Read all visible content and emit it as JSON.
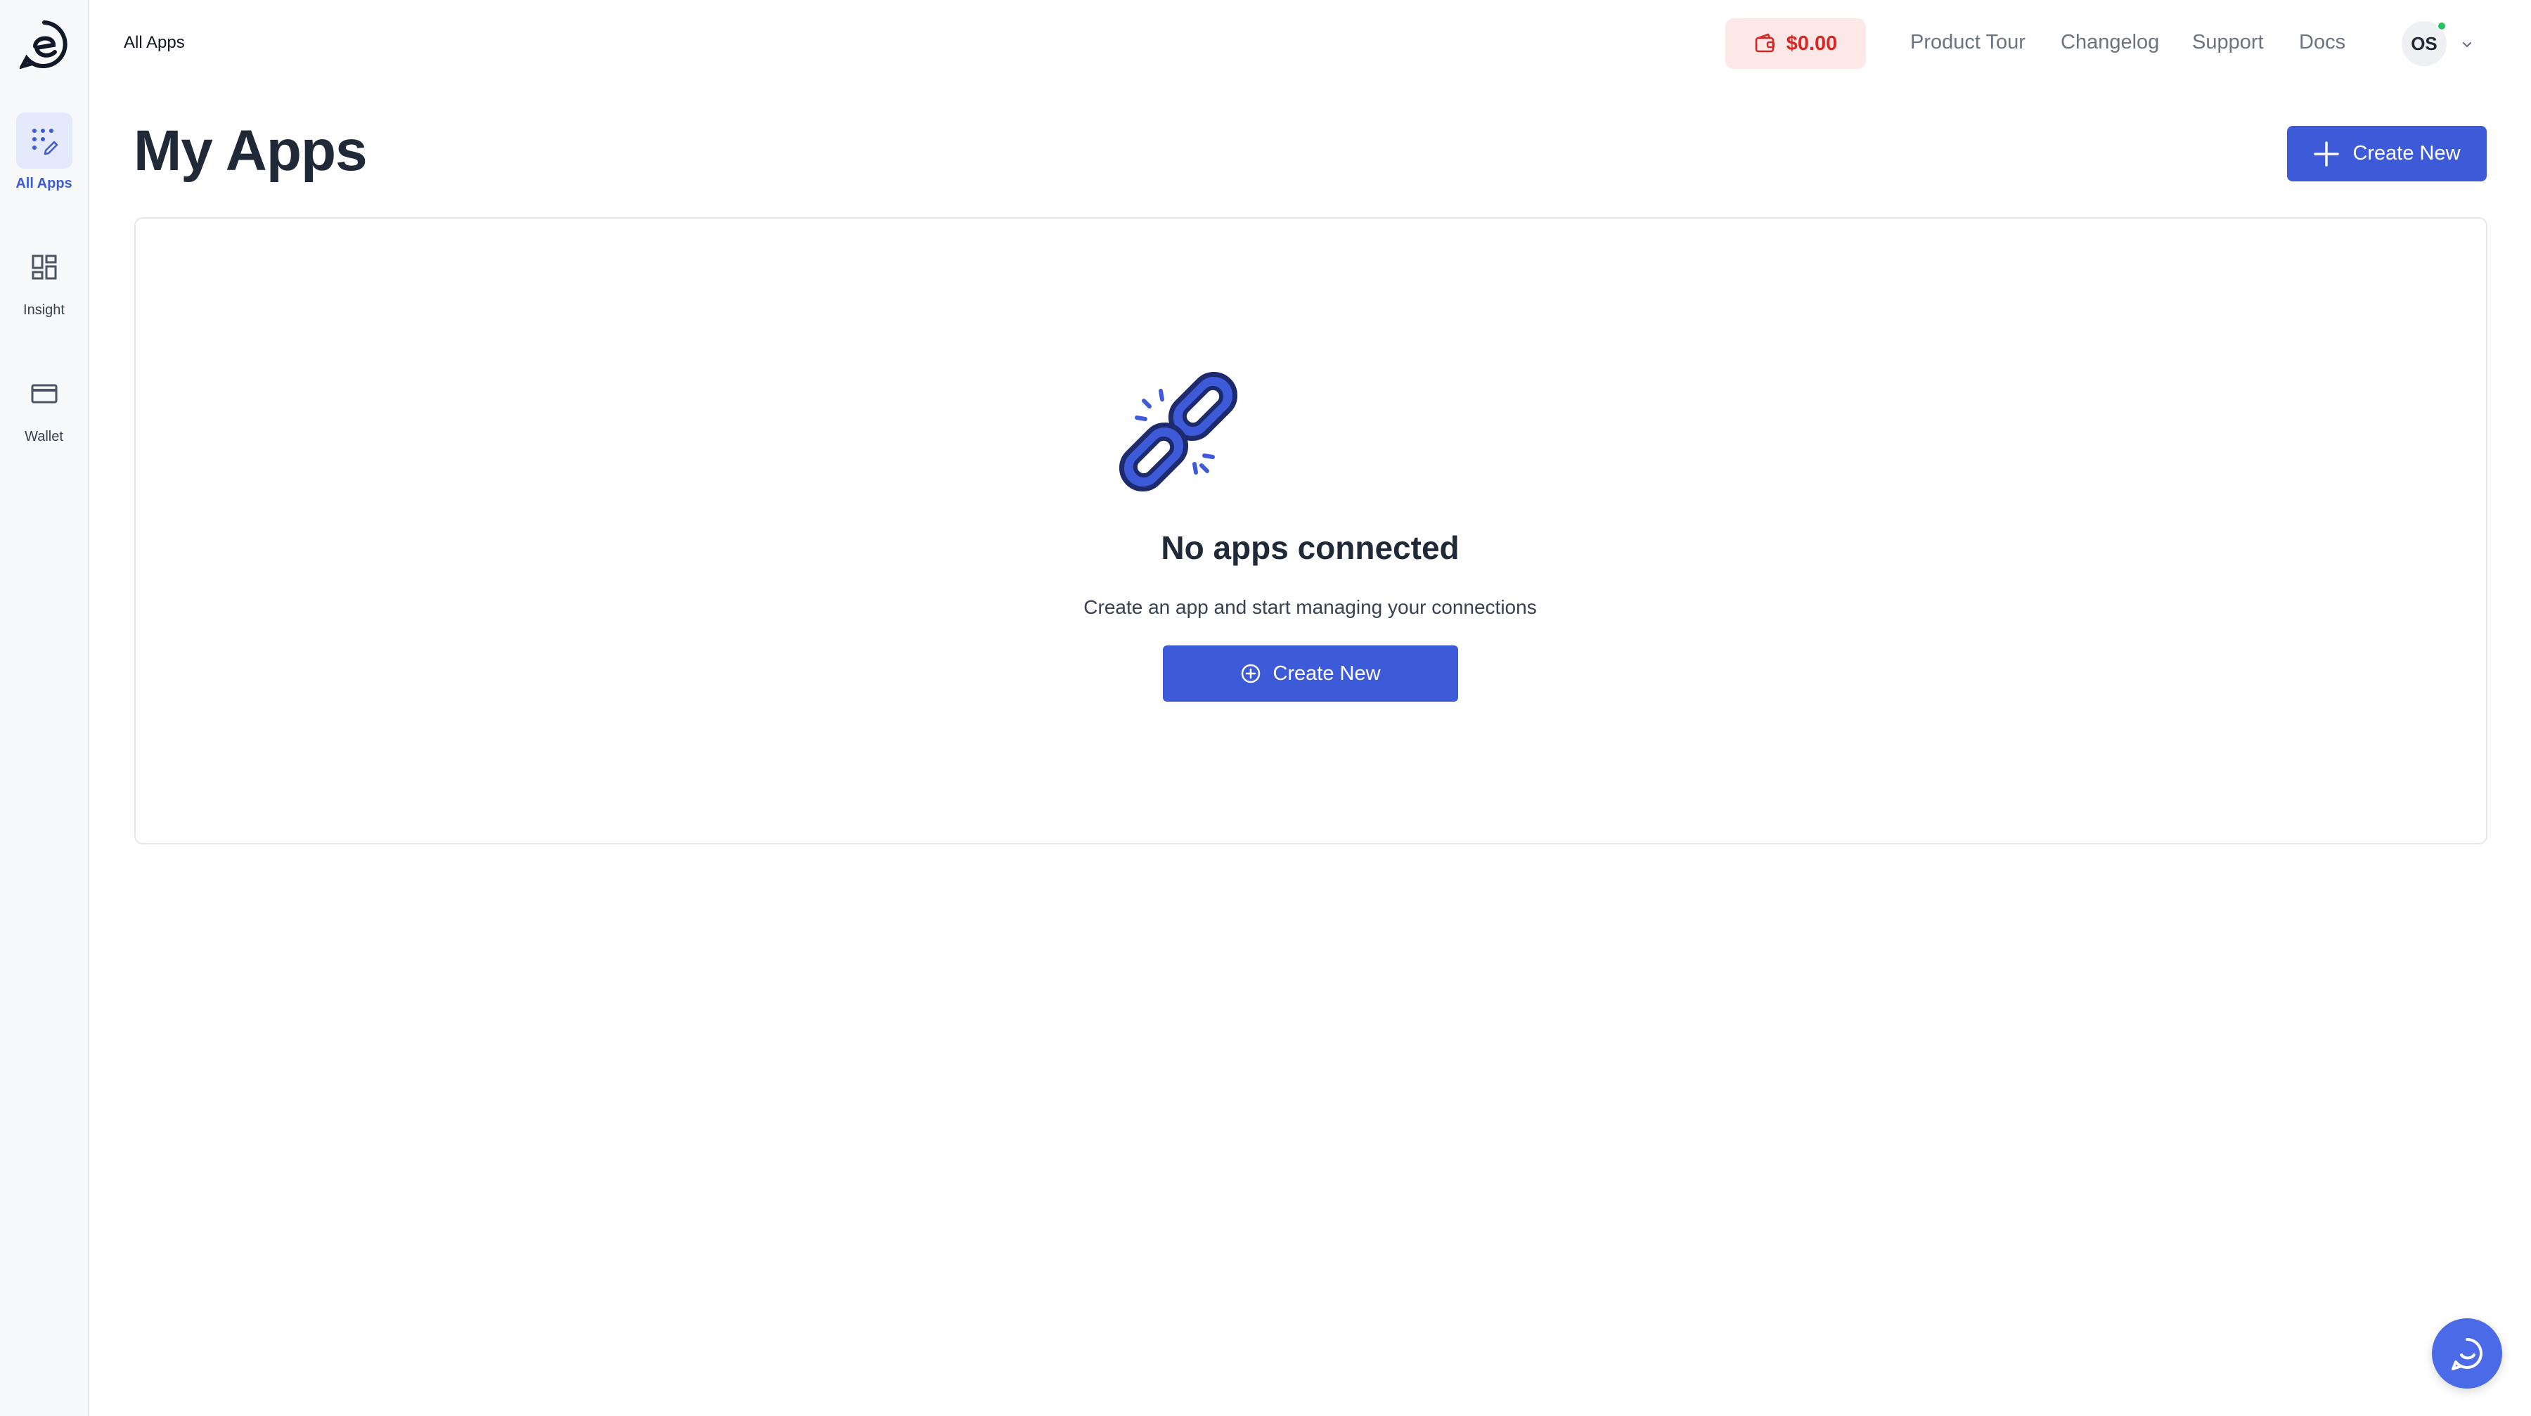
{
  "sidebar": {
    "logo": "ecologi-logo",
    "items": [
      {
        "label": "All Apps",
        "icon": "grid-edit-icon",
        "active": true
      },
      {
        "label": "Insight",
        "icon": "dashboard-icon",
        "active": false
      },
      {
        "label": "Wallet",
        "icon": "credit-card-icon",
        "active": false
      }
    ]
  },
  "header": {
    "breadcrumb": "All Apps",
    "balance": "$0.00",
    "links": [
      "Product Tour",
      "Changelog",
      "Support",
      "Docs"
    ],
    "avatar_initials": "OS"
  },
  "main": {
    "title": "My Apps",
    "create_label": "Create New",
    "empty_state": {
      "icon": "broken-link-icon",
      "title": "No apps connected",
      "subtitle": "Create an app and start managing your connections",
      "button_label": "Create New"
    }
  },
  "colors": {
    "accent": "#3d5bd9",
    "balance_bg": "#fde8e8",
    "balance_text": "#dc2626",
    "online": "#22c55e"
  }
}
